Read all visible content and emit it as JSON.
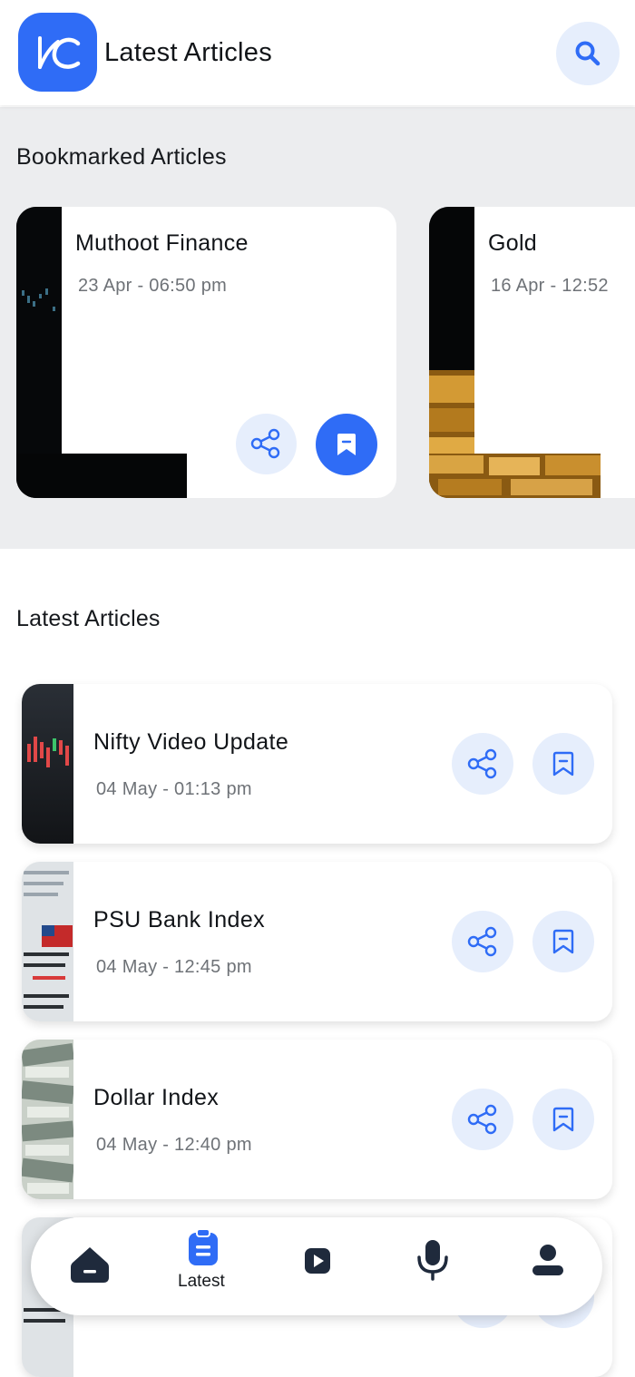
{
  "app_bar": {
    "title": "Latest Articles",
    "logo_icon": "kc-logo-icon",
    "search_icon": "search-icon"
  },
  "bookmarked": {
    "heading": "Bookmarked Articles",
    "items": [
      {
        "title": "Muthoot Finance",
        "date": "23 Apr - 06:50 pm",
        "thumbnail": "stock-chart-dark"
      },
      {
        "title": "Gold",
        "date": "16 Apr - 12:52",
        "thumbnail": "gold-bars"
      }
    ]
  },
  "latest": {
    "heading": "Latest Articles",
    "items": [
      {
        "title": "Nifty Video Update",
        "date": "04 May - 01:13 pm",
        "thumbnail": "candlestick-chart"
      },
      {
        "title": "PSU Bank Index",
        "date": "04 May - 12:45 pm",
        "thumbnail": "stock-ticker-newspaper"
      },
      {
        "title": "Dollar Index",
        "date": "04 May - 12:40 pm",
        "thumbnail": "dollar-bills"
      },
      {
        "title": "",
        "date": "",
        "thumbnail": "stock-ticker-newspaper"
      }
    ]
  },
  "bottom_nav": {
    "items": [
      {
        "icon": "home-icon",
        "label": ""
      },
      {
        "icon": "articles-icon",
        "label": "Latest",
        "active": true
      },
      {
        "icon": "video-play-icon",
        "label": ""
      },
      {
        "icon": "microphone-icon",
        "label": ""
      },
      {
        "icon": "profile-icon",
        "label": ""
      }
    ]
  },
  "colors": {
    "accent": "#2f6cf6",
    "accent_soft": "#e6eefc",
    "nav_icon_dark": "#1f2a3c",
    "section_bg": "#ecedef",
    "date_text": "#6e7277"
  }
}
